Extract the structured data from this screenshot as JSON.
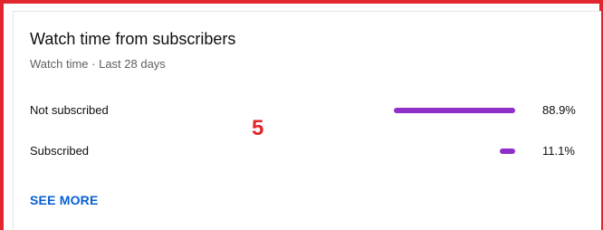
{
  "card": {
    "title": "Watch time from subscribers",
    "subtitle": "Watch time · Last 28 days",
    "rows": [
      {
        "label": "Not subscribed",
        "percent_text": "88.9%",
        "fraction": 0.889
      },
      {
        "label": "Subscribed",
        "percent_text": "11.1%",
        "fraction": 0.111
      }
    ],
    "see_more_label": "SEE MORE"
  },
  "annotation": {
    "label": "5"
  },
  "colors": {
    "bar": "#8e2fc7",
    "link": "#065fd4",
    "annotation": "#e1262d"
  }
}
